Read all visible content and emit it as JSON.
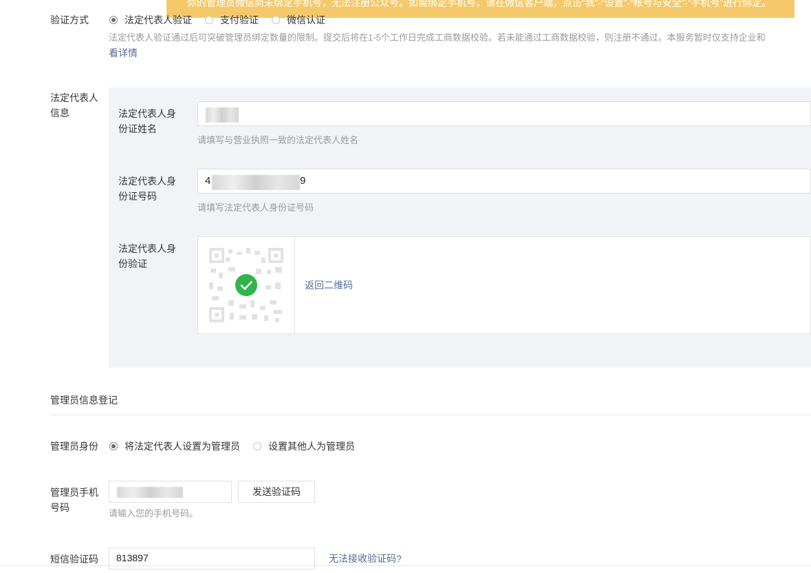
{
  "banner": {
    "text": "你的管理员微信尚未绑定手机号，无法注册公众号。如需绑定手机号，请在微信客户端，点击“我”-“设置”-“帐号与安全”-“手机号”进行绑定。"
  },
  "verify": {
    "label": "验证方式",
    "options": [
      {
        "label": "法定代表人验证",
        "checked": true
      },
      {
        "label": "支付验证",
        "checked": false
      },
      {
        "label": "微信认证",
        "checked": false
      }
    ],
    "desc": "法定代表人验证通过后可突破管理员绑定数量的限制。提交后将在1-5个工作日完成工商数据校验。若未能通过工商数据校验，则注册不通过。本服务暂时仅支持企业和",
    "more_link": "看详情"
  },
  "legal": {
    "section_label_1": "法定代表人",
    "section_label_2": "信息",
    "name_label_1": "法定代表人身",
    "name_label_2": "份证姓名",
    "name_hint": "请填写与营业执照一致的法定代表人姓名",
    "id_label_1": "法定代表人身",
    "id_label_2": "份证号码",
    "id_first": "4",
    "id_last": "9",
    "id_hint": "请填写法定代表人身份证号码",
    "auth_label_1": "法定代表人身",
    "auth_label_2": "份验证",
    "qr_back_link": "返回二维码"
  },
  "admin": {
    "section_title": "管理员信息登记",
    "identity_label": "管理员身份",
    "identity_options": [
      {
        "label": "将法定代表人设置为管理员",
        "checked": true
      },
      {
        "label": "设置其他人为管理员",
        "checked": false
      }
    ],
    "phone_label_1": "管理员手机",
    "phone_label_2": "号码",
    "send_code_button": "发送验证码",
    "phone_hint": "请输入您的手机号码。",
    "sms_label": "短信验证码",
    "sms_value": "813897",
    "sms_help_link": "无法接收验证码?"
  },
  "colors": {
    "banner_bg": "#f5c96a",
    "link": "#576b95",
    "success": "#2fb548",
    "panel_bg": "#f2f3f6"
  },
  "icons": [
    "radio-icon",
    "qr-code-icon",
    "check-circle-icon"
  ]
}
